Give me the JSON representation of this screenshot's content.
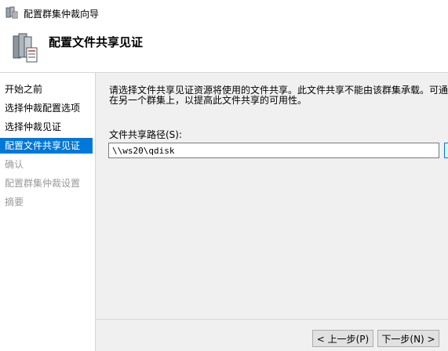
{
  "window": {
    "title": "配置群集仲裁向导"
  },
  "header": {
    "title": "配置文件共享见证"
  },
  "sidebar": {
    "items": [
      {
        "label": "开始之前",
        "state": "normal"
      },
      {
        "label": "选择仲裁配置选项",
        "state": "normal"
      },
      {
        "label": "选择仲裁见证",
        "state": "normal"
      },
      {
        "label": "配置文件共享见证",
        "state": "selected"
      },
      {
        "label": "确认",
        "state": "disabled"
      },
      {
        "label": "配置群集仲裁设置",
        "state": "disabled"
      },
      {
        "label": "摘要",
        "state": "disabled"
      }
    ]
  },
  "main": {
    "description_line1": "请选择文件共享见证资源将使用的文件共享。此文件共享不能由该群集承载。可通",
    "description_line2": "在另一个群集上，以提高此文件共享的可用性。",
    "path_label": "文件共享路径(S):",
    "path_value": "\\\\ws20\\qdisk"
  },
  "footer": {
    "prev_label": "< 上一步(P)",
    "next_label": "下一步(N) >"
  },
  "colors": {
    "selection": "#0078d7",
    "panel": "#f0f0f0",
    "disabled_text": "#9a9a9a"
  }
}
